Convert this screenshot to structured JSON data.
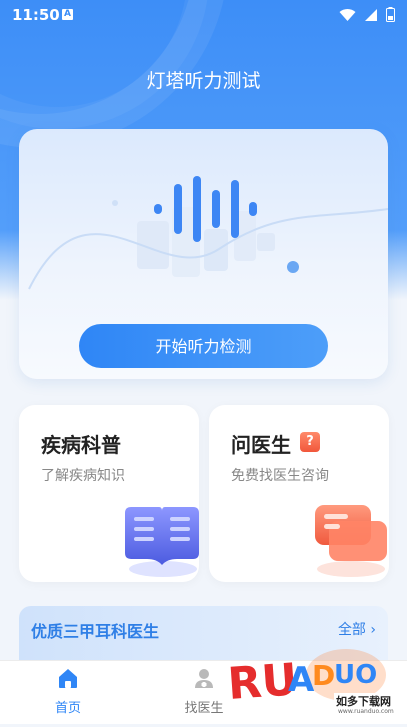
{
  "status_bar": {
    "time": "11:50",
    "notification_letter": "A"
  },
  "app_title": "灯塔听力测试",
  "hero": {
    "start_button_label": "开始听力检测"
  },
  "tiles": [
    {
      "title": "疾病科普",
      "subtitle": "了解疾病知识",
      "icon": "book-icon"
    },
    {
      "title": "问医生",
      "badge": "?",
      "subtitle": "免费找医生咨询",
      "icon": "chat-icon"
    }
  ],
  "doctors_section": {
    "title": "优质三甲耳科医生",
    "more_label": "全部"
  },
  "tab_bar": {
    "home_label": "首页",
    "find_doctor_label": "找医生"
  },
  "watermark": {
    "brand": "RUANDUO",
    "caption": "如多下载网",
    "url": "www.ruanduo.com"
  },
  "colors": {
    "primary": "#3d8ef7",
    "accent": "#f1573b",
    "tab_active": "#2f86f6"
  }
}
